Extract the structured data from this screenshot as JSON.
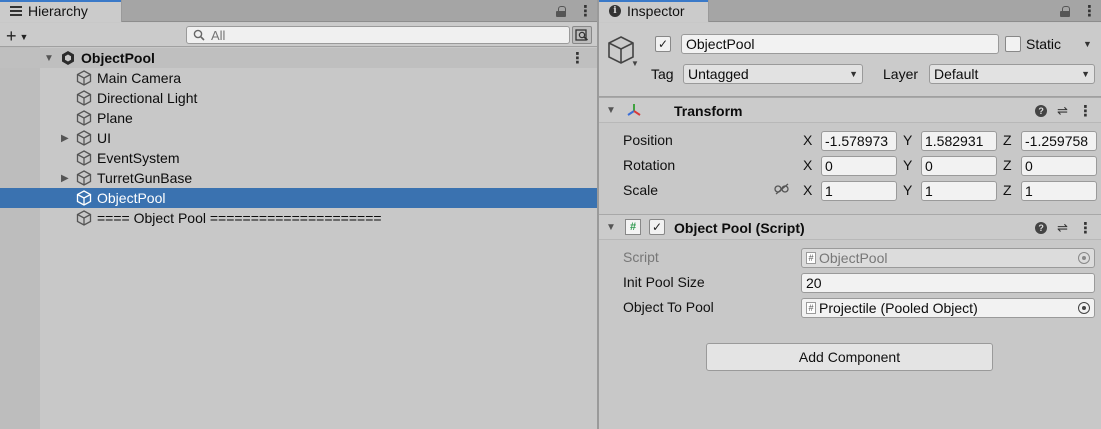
{
  "hierarchy": {
    "tab_label": "Hierarchy",
    "search_placeholder": "All",
    "scene": "ObjectPool",
    "items": [
      {
        "name": "Main Camera",
        "expandable": false,
        "selected": false
      },
      {
        "name": "Directional Light",
        "expandable": false,
        "selected": false
      },
      {
        "name": "Plane",
        "expandable": false,
        "selected": false
      },
      {
        "name": "UI",
        "expandable": true,
        "selected": false
      },
      {
        "name": "EventSystem",
        "expandable": false,
        "selected": false
      },
      {
        "name": "TurretGunBase",
        "expandable": true,
        "selected": false
      },
      {
        "name": "ObjectPool",
        "expandable": false,
        "selected": true
      },
      {
        "name": "==== Object Pool =====================",
        "expandable": false,
        "selected": false
      }
    ],
    "selection_color": "#3a72b0"
  },
  "inspector": {
    "tab_label": "Inspector",
    "object_name": "ObjectPool",
    "static_label": "Static",
    "tag_label": "Tag",
    "tag_value": "Untagged",
    "layer_label": "Layer",
    "layer_value": "Default",
    "transform": {
      "title": "Transform",
      "position_label": "Position",
      "rotation_label": "Rotation",
      "scale_label": "Scale",
      "position": {
        "x": "-1.578973",
        "y": "1.582931",
        "z": "-1.259758"
      },
      "rotation": {
        "x": "0",
        "y": "0",
        "z": "0"
      },
      "scale": {
        "x": "1",
        "y": "1",
        "z": "1"
      },
      "axis_x": "X",
      "axis_y": "Y",
      "axis_z": "Z"
    },
    "script_component": {
      "title": "Object Pool (Script)",
      "script_label": "Script",
      "script_value": "ObjectPool",
      "init_pool_size_label": "Init Pool Size",
      "init_pool_size_value": "20",
      "object_to_pool_label": "Object To Pool",
      "object_to_pool_value": "Projectile (Pooled Object)"
    },
    "add_component_label": "Add Component"
  }
}
